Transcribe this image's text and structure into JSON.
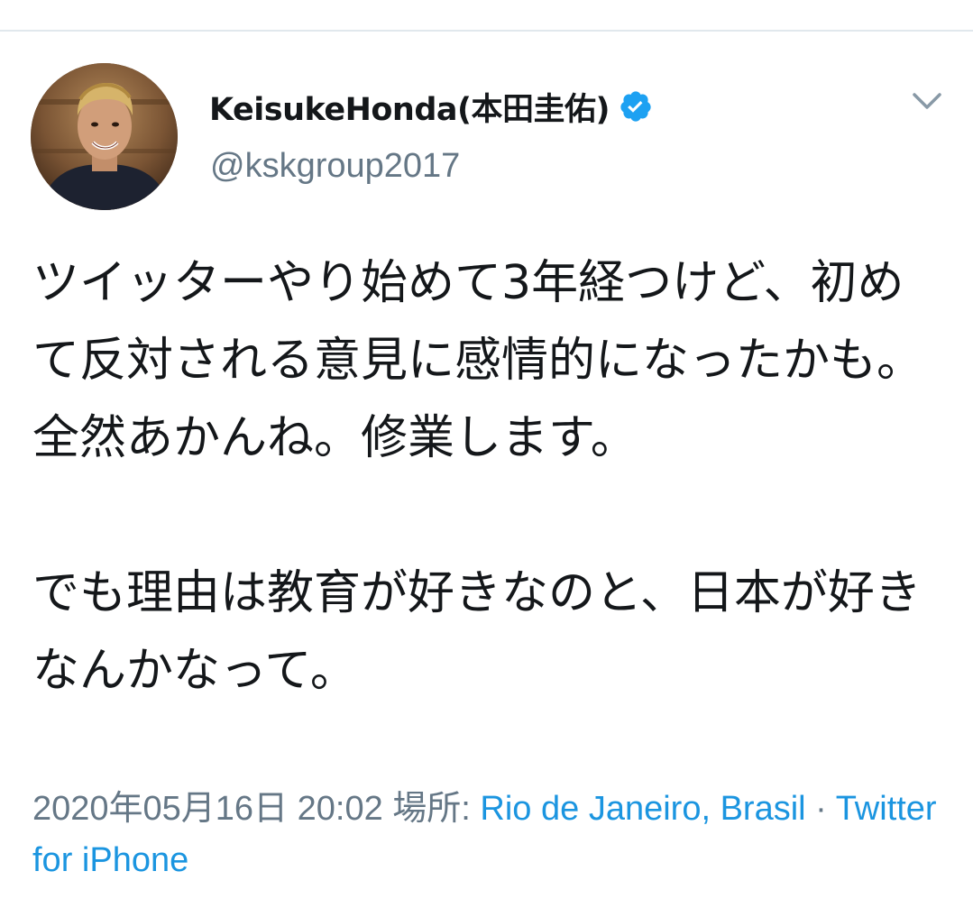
{
  "tweet": {
    "author": {
      "display_name": "KeisukeHonda(本田圭佑)",
      "handle": "@kskgroup2017",
      "verified": true,
      "avatar_icon": "profile-photo"
    },
    "menu_icon": "chevron-down-icon",
    "text": "ツイッターやり始めて3年経つけど、初めて反対される意見に感情的になったかも。全然あかんね。修業します。\n\nでも理由は教育が好きなのと、日本が好きなんかなって。",
    "meta": {
      "timestamp": "2020年05月16日 20:02",
      "location_label": "場所:",
      "location": "Rio de Janeiro, Brasil",
      "separator": "·",
      "source": "Twitter for iPhone"
    }
  },
  "colors": {
    "text_primary": "#14171a",
    "text_secondary": "#657786",
    "link": "#1b95e0",
    "verified_badge": "#1da1f2",
    "divider": "#e1e8ed"
  }
}
